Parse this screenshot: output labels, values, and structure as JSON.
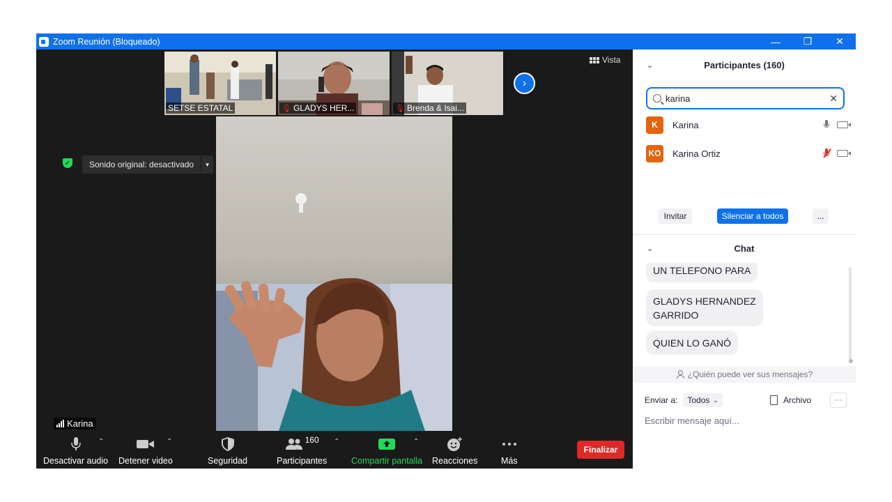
{
  "window": {
    "title": "Zoom Reunión (Bloqueado)"
  },
  "thumbnails": [
    {
      "name": "SETSE ESTATAL",
      "muted": false
    },
    {
      "name": "GLADYS HER...",
      "muted": true
    },
    {
      "name": "Brenda & Isai...",
      "muted": true
    }
  ],
  "view": {
    "label": "Vista"
  },
  "sound": {
    "label": "Sonido original: desactivado"
  },
  "speaker": {
    "name": "Karina"
  },
  "toolbar": {
    "audio": "Desactivar audio",
    "video": "Detener video",
    "security": "Seguridad",
    "participants": "Participantes",
    "participants_count": "160",
    "share": "Compartir pantalla",
    "reactions": "Reacciones",
    "more": "Más",
    "end": "Finalizar"
  },
  "participants_panel": {
    "title": "Participantes (160)",
    "search_value": "karina",
    "results": [
      {
        "initials": "K",
        "name": "Karina",
        "mic_muted": false
      },
      {
        "initials": "KO",
        "name": "Karina Ortiz",
        "mic_muted": true
      }
    ],
    "invite": "Invitar",
    "mute_all": "Silenciar a todos",
    "more": "..."
  },
  "chat": {
    "title": "Chat",
    "messages": [
      "UN TELEFONO PARA",
      "GLADYS HERNANDEZ GARRIDO",
      "QUIEN LO GANÓ"
    ],
    "who_sees": "¿Quién puede ver sus mensajes?",
    "send_to_label": "Enviar a:",
    "send_to_value": "Todos",
    "file": "Archivo",
    "placeholder": "Escribir mensaje aquí..."
  },
  "colors": {
    "zoom_blue": "#0e71eb",
    "end_red": "#e02828",
    "share_green": "#23d959",
    "avatar_orange": "#e4630f"
  }
}
